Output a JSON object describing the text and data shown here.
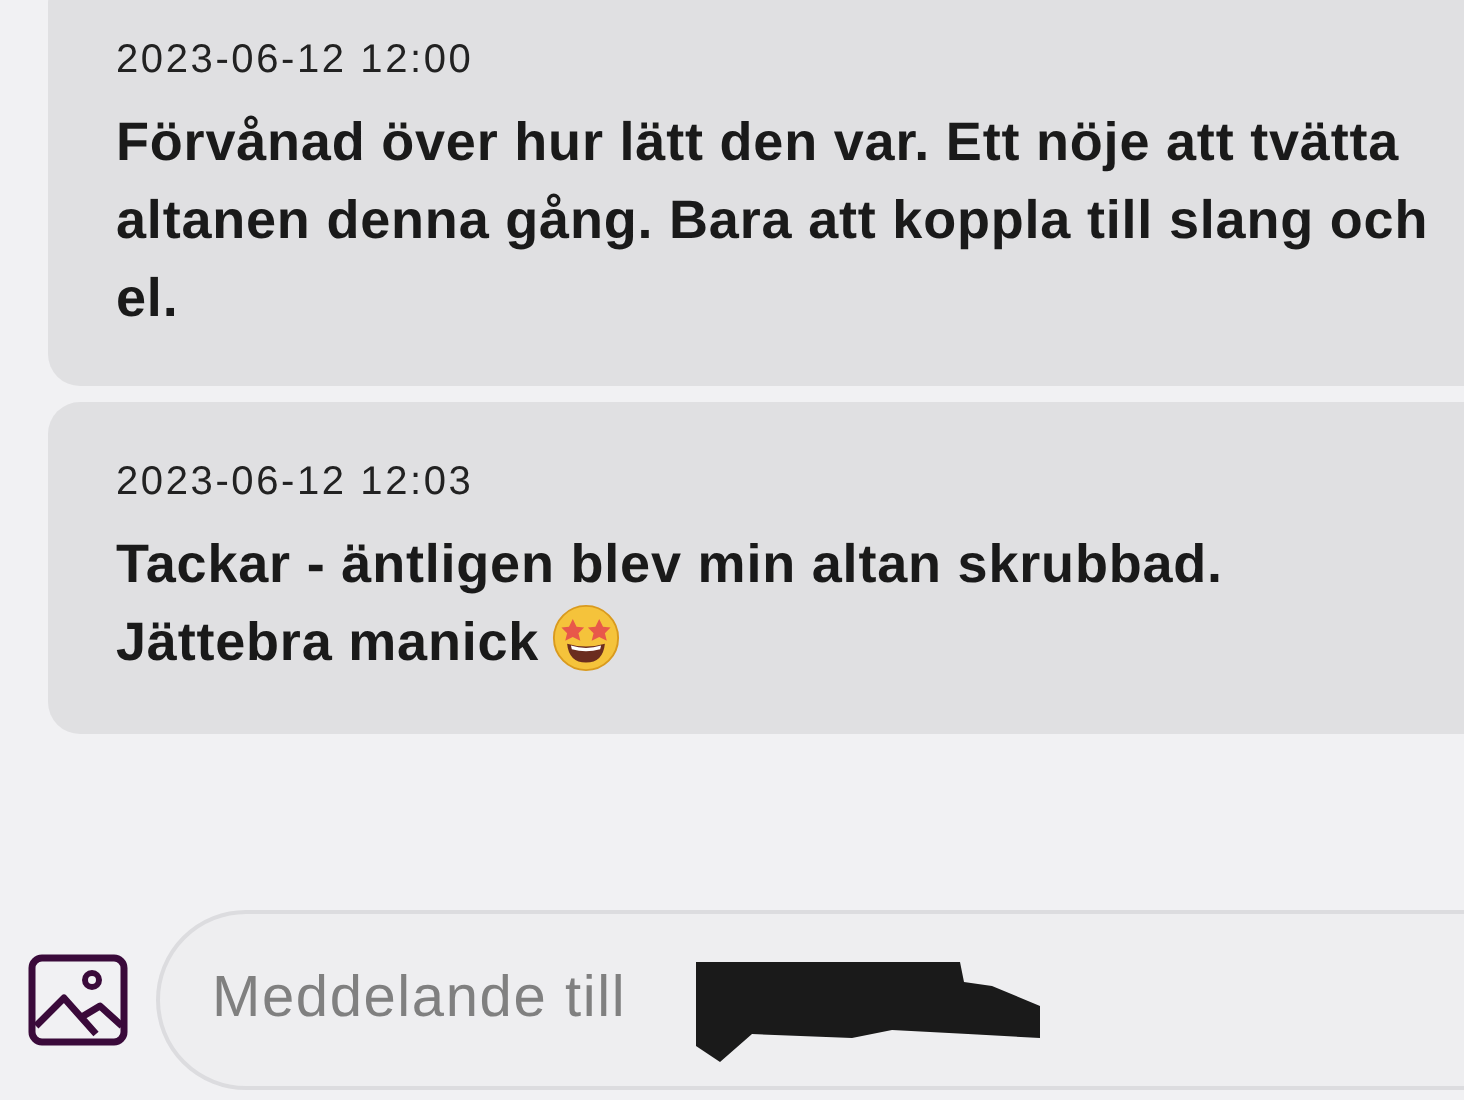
{
  "messages": [
    {
      "timestamp": "2023-06-12 12:00",
      "text": "Förvånad över hur lätt den var. Ett nöje att tvätta altanen denna gång. Bara att koppla till slang och el."
    },
    {
      "timestamp": "2023-06-12 12:03",
      "text": "Tackar - äntligen blev min altan skrubbad. Jättebra manick",
      "emoji": true
    }
  ],
  "composer": {
    "placeholder": "Meddelande till",
    "redacted": true
  }
}
